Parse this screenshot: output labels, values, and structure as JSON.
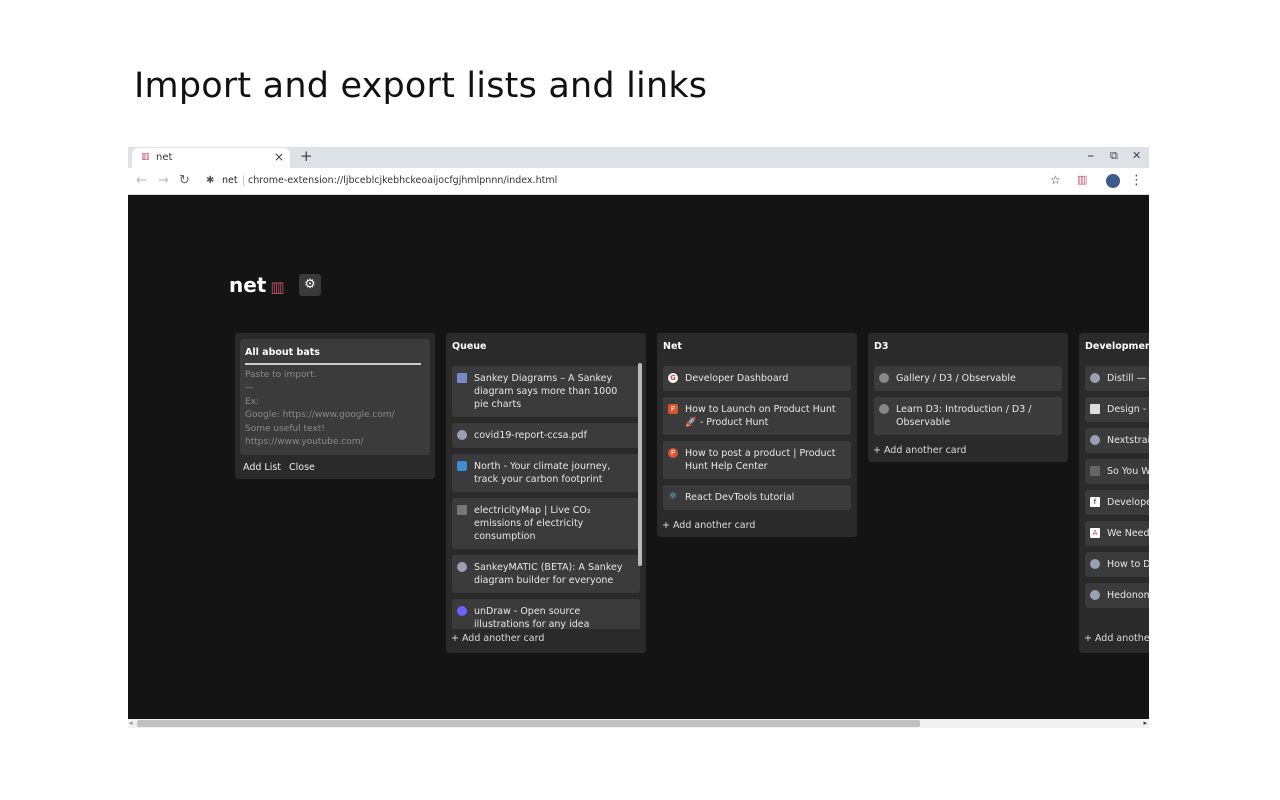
{
  "slide": {
    "title": "Import and export lists and links"
  },
  "browser": {
    "tab_title": "net",
    "tab_close": "×",
    "new_tab": "+",
    "win_min": "⎯",
    "win_max": "⧉",
    "win_close": "✕",
    "ext_name": "net",
    "url": "chrome-extension://ljbceblcjkebhckeoaijocfgjhmlpnnn/index.html"
  },
  "app": {
    "title": "net",
    "title_emoji": "▥",
    "import_list": {
      "name": "All about bats",
      "placeholder": "Paste to import.\n—\nEx:\nGoogle: https://www.google.com/\nSome useful text!\nhttps://www.youtube.com/",
      "add_list": "Add List",
      "close": "Close"
    },
    "add_card_label": "+ Add another card",
    "add_card_label_cut": "+ Add another c",
    "lists": [
      {
        "title": "Queue",
        "cards": [
          {
            "text": "Sankey Diagrams – A Sankey diagram says more than 1000 pie charts",
            "color": "#7a88c8"
          },
          {
            "text": "covid19-report-ccsa.pdf",
            "color": "#9aa0b4"
          },
          {
            "text": "North - Your climate journey, track your carbon footprint",
            "color": "#3c8fd6"
          },
          {
            "text": "electricityMap | Live CO₂ emissions of electricity consumption",
            "color": "#777777"
          },
          {
            "text": "SankeyMATIC (BETA): A Sankey diagram builder for everyone",
            "color": "#9aa0b4"
          },
          {
            "text": "unDraw - Open source illustrations for any idea",
            "color": "#6c63ff"
          }
        ]
      },
      {
        "title": "Net",
        "cards": [
          {
            "text": "Developer Dashboard",
            "color": "#ea4335"
          },
          {
            "text": "How to Launch on Product Hunt 🚀 - Product Hunt",
            "color": "#da552f"
          },
          {
            "text": "How to post a product | Product Hunt Help Center",
            "color": "#da552f"
          },
          {
            "text": "React DevTools tutorial",
            "color": "#61dafb"
          }
        ]
      },
      {
        "title": "D3",
        "cards": [
          {
            "text": "Gallery / D3 / Observable",
            "color": "#888888"
          },
          {
            "text": "Learn D3: Introduction / D3 / Observable",
            "color": "#888888"
          }
        ]
      },
      {
        "title": "Development",
        "cards": [
          {
            "text": "Distill — La machine le",
            "color": "#9aa0b4"
          },
          {
            "text": "Design - Ma",
            "color": "#dddddd"
          },
          {
            "text": "Nextstrain",
            "color": "#9aa0b4"
          },
          {
            "text": "So You Wa Susan Fow",
            "color": "#666666"
          },
          {
            "text": "Developer",
            "color": "#222222"
          },
          {
            "text": "We Need a - The Atlan",
            "color": "#e03131"
          },
          {
            "text": "How to Do",
            "color": "#9aa0b4"
          },
          {
            "text": "Hedonome",
            "color": "#9aa0b4"
          }
        ]
      }
    ]
  }
}
